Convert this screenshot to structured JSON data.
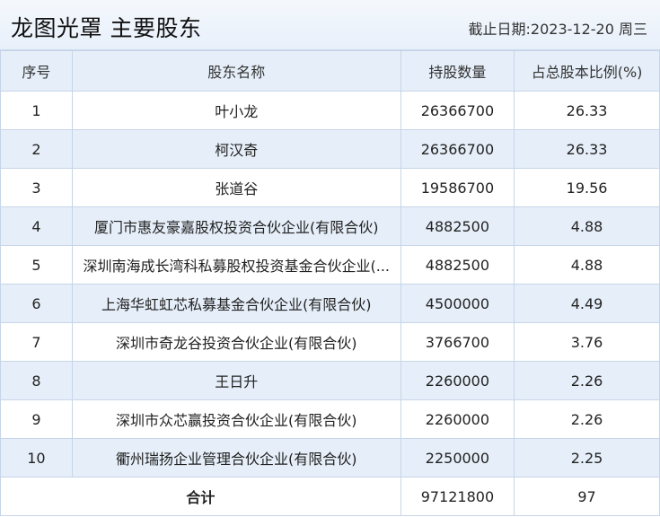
{
  "header": {
    "title": "龙图光罩 主要股东",
    "date": "截止日期:2023-12-20 周三"
  },
  "columns": [
    "序号",
    "股东名称",
    "持股数量",
    "占总股本比例(%)"
  ],
  "rows": [
    {
      "index": "1",
      "name": "叶小龙",
      "shares": "26366700",
      "ratio": "26.33"
    },
    {
      "index": "2",
      "name": "柯汉奇",
      "shares": "26366700",
      "ratio": "26.33"
    },
    {
      "index": "3",
      "name": "张道谷",
      "shares": "19586700",
      "ratio": "19.56"
    },
    {
      "index": "4",
      "name": "厦门市惠友豪嘉股权投资合伙企业(有限合伙)",
      "shares": "4882500",
      "ratio": "4.88"
    },
    {
      "index": "5",
      "name": "深圳南海成长湾科私募股权投资基金合伙企业(...",
      "shares": "4882500",
      "ratio": "4.88"
    },
    {
      "index": "6",
      "name": "上海华虹虹芯私募基金合伙企业(有限合伙)",
      "shares": "4500000",
      "ratio": "4.49"
    },
    {
      "index": "7",
      "name": "深圳市奇龙谷投资合伙企业(有限合伙)",
      "shares": "3766700",
      "ratio": "3.76"
    },
    {
      "index": "8",
      "name": "王日升",
      "shares": "2260000",
      "ratio": "2.26"
    },
    {
      "index": "9",
      "name": "深圳市众芯赢投资合伙企业(有限合伙)",
      "shares": "2260000",
      "ratio": "2.26"
    },
    {
      "index": "10",
      "name": "衢州瑞扬企业管理合伙企业(有限合伙)",
      "shares": "2250000",
      "ratio": "2.25"
    }
  ],
  "total": {
    "label": "合计",
    "shares": "97121800",
    "ratio": "97"
  }
}
